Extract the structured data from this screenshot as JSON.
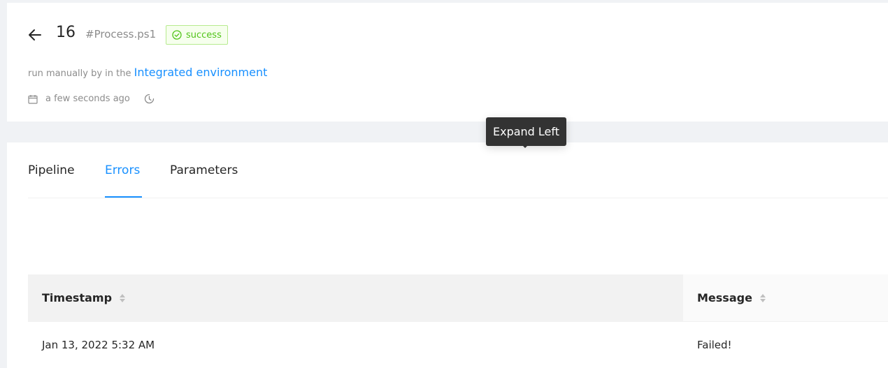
{
  "header": {
    "back_icon": "arrow-left-icon",
    "run_number": "16",
    "pipeline_name": "#Process.ps1",
    "status": {
      "label": "success",
      "icon": "check-circle-icon",
      "color": "#52c41a"
    },
    "trigger_text": "run manually by in the",
    "environment_link": "Integrated environment",
    "time_icon": "calendar-icon",
    "time_text": "a few seconds ago",
    "duration_icon": "clock-icon"
  },
  "tabs": [
    {
      "label": "Pipeline",
      "active": false
    },
    {
      "label": "Errors",
      "active": true
    },
    {
      "label": "Parameters",
      "active": false
    }
  ],
  "table": {
    "columns": [
      "Timestamp",
      "Message"
    ],
    "rows": [
      {
        "timestamp": "Jan 13, 2022 5:32 AM",
        "message": "Failed!"
      }
    ]
  },
  "tooltip": {
    "text": "Expand Left"
  },
  "colors": {
    "accent": "#1890ff",
    "success": "#52c41a",
    "background": "#f0f2f5"
  }
}
